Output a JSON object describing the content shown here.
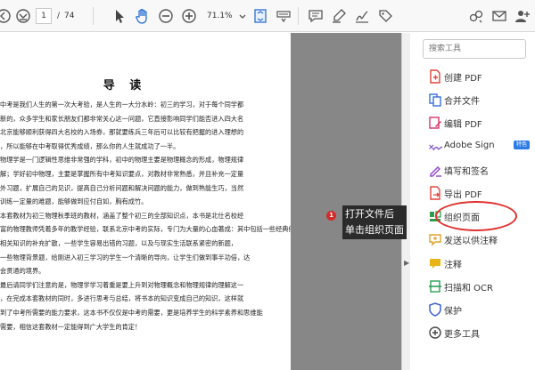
{
  "toolbar": {
    "current_page": "1",
    "page_separator": "/",
    "total_pages": "74",
    "zoom": "71.1%",
    "icons": [
      "arrow-left-icon",
      "page-down-icon",
      "select-cursor-icon",
      "hand-icon",
      "zoom-out-icon",
      "zoom-in-icon",
      "zoom-dropdown-icon",
      "fit-page-icon",
      "keyboard-icon",
      "comment-icon",
      "highlighter-icon",
      "sign-icon",
      "tag-icon",
      "share-link-icon",
      "mail-icon",
      "add-user-icon"
    ]
  },
  "document": {
    "title": "导 读",
    "lines": [
      "中考是我们人生的第一次大考验，是人生的一大分水岭：初三的学习，对于每个同学都",
      "新的，众多学生和家长朋友们都非常关心这一问题，它直接影响同学们能否进入四大名",
      "北京能够顺利获得四大名校的入场券，那就要练兵三年后可以比较有把握的进入理想的",
      "，所以能够在中考取得优秀成绩，那么你的人生就成功了一半。",
      "物理学是一门逻辑性思维非常强的学科，初中的物理主要是物理概念的形成，物理规律",
      "解；学好初中物理，主要是掌握所有中考知识要点，对教材非常熟悉，并且补充一定量",
      "外习题，扩展自己的见识，提高自己分析问题和解决问题的能力，做到熟能生巧，当然",
      "训练一定量的难题，能够做到应付自如，胸有成竹。",
      "本套教材为初三物理秋季班的教材，涵盖了整个初三的全部知识点，本书是北仕名校经",
      "富的物理教师凭着多年的教学经验，联系北京中考的实际，专门为大量的心血著成：其中包括一些经典例题的透",
      "相关知识的补充扩散，一些学生容易出错的习题，以及与现实生活联系紧密的新题，",
      "一些物理背景题，给刚进入初三学习的学生一个清晰的导向，让学生们做到事半功倍，达",
      "会贯通的境界。",
      "最后请同学们注意的是，物理学学习着重是要上升到对物理概念和物理规律的理解这一",
      "，在完成本套教材的同时，多进行思考与总结，将书本的知识变成自己的知识，这样就",
      "到了中考所需要的能力要求，这本书不仅仅是中考的需要，更是培养学生的科学素养和思维能",
      "需要，相信这套教材一定能得到广大学生的肯定！"
    ]
  },
  "tools_pane": {
    "search_placeholder": "搜索工具",
    "items": [
      {
        "label": "创建 PDF",
        "icon": "create-pdf-icon",
        "color": "#e0443c"
      },
      {
        "label": "合并文件",
        "icon": "combine-files-icon",
        "color": "#3a6fd8"
      },
      {
        "label": "编辑 PDF",
        "icon": "edit-pdf-icon",
        "color": "#d6336c"
      },
      {
        "label": "Adobe Sign",
        "icon": "adobe-sign-icon",
        "color": "#7a4cc9",
        "badge": "特色"
      },
      {
        "label": "填写和签名",
        "icon": "fill-sign-icon",
        "color": "#8e44c9"
      },
      {
        "label": "导出 PDF",
        "icon": "export-pdf-icon",
        "color": "#e0443c"
      },
      {
        "label": "组织页面",
        "icon": "organize-pages-icon",
        "color": "#2e9e4a"
      },
      {
        "label": "发送以供注释",
        "icon": "send-for-comments-icon",
        "color": "#e0a12c"
      },
      {
        "label": "注释",
        "icon": "comment-icon",
        "color": "#e8b518"
      },
      {
        "label": "扫描和 OCR",
        "icon": "scan-ocr-icon",
        "color": "#2b9e55"
      },
      {
        "label": "保护",
        "icon": "protect-icon",
        "color": "#3a5fd0"
      },
      {
        "label": "更多工具",
        "icon": "more-tools-icon",
        "color": "#444444"
      }
    ]
  },
  "annotation": {
    "number": "1",
    "line1": "打开文件后",
    "line2": "单击组织页面"
  },
  "colors": {
    "highlight": "#e03030",
    "gutter": "#878787",
    "callout_bg": "#2b2b2b"
  }
}
